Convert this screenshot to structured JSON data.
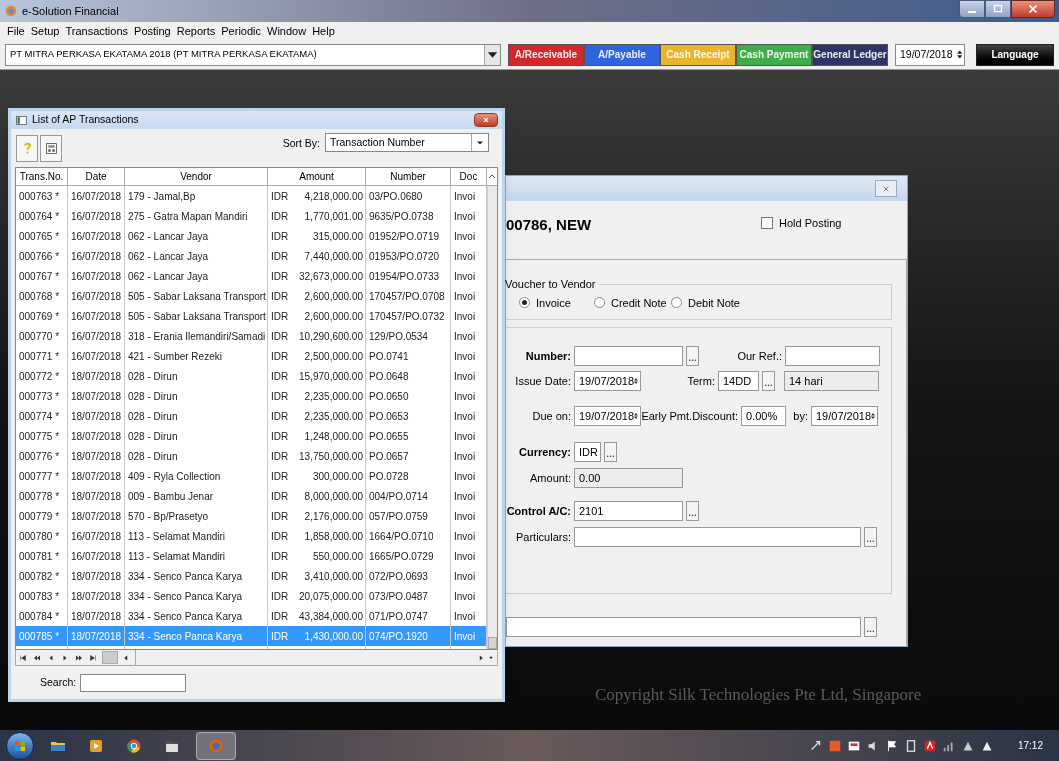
{
  "window": {
    "title": "e-Solution Financial"
  },
  "menu": [
    "File",
    "Setup",
    "Transactions",
    "Posting",
    "Reports",
    "Periodic",
    "Window",
    "Help"
  ],
  "toolbar": {
    "company": "PT MITRA PERKASA EKATAMA 2018 (PT MITRA PERKASA EKATAMA)",
    "modules": [
      {
        "label": "A/Receivable",
        "color": "#d2282c"
      },
      {
        "label": "A/Payable",
        "color": "#2f63e0"
      },
      {
        "label": "Cash Receipt",
        "color": "#e9b52c"
      },
      {
        "label": "Cash Payment",
        "color": "#3fae4a"
      },
      {
        "label": "General Ledger",
        "color": "#2e3566"
      }
    ],
    "date": "19/07/2018",
    "language": "Language"
  },
  "list_window": {
    "title": "List of AP Transactions",
    "sort_by_label": "Sort By:",
    "sort_by": "Transaction Number",
    "columns": [
      "Trans.No.",
      "Date",
      "Vendor",
      "Amount",
      "Number",
      "Doc"
    ],
    "rows": [
      {
        "trans_no": "000763 *",
        "date": "16/07/2018",
        "vendor": "179 - Jamal,Bp",
        "amount": {
          "currency": "IDR",
          "value": "4,218,000.00"
        },
        "number": "03/PO.0680",
        "doc": "Invoi",
        "selected": false
      },
      {
        "trans_no": "000764 *",
        "date": "16/07/2018",
        "vendor": "275 - Gatra Mapan Mandiri",
        "amount": {
          "currency": "IDR",
          "value": "1,770,001.00"
        },
        "number": "9635/PO.0738",
        "doc": "Invoi",
        "selected": false
      },
      {
        "trans_no": "000765 *",
        "date": "16/07/2018",
        "vendor": "062 - Lancar Jaya",
        "amount": {
          "currency": "IDR",
          "value": "315,000.00"
        },
        "number": "01952/PO.0719",
        "doc": "Invoi",
        "selected": false
      },
      {
        "trans_no": "000766 *",
        "date": "16/07/2018",
        "vendor": "062 - Lancar Jaya",
        "amount": {
          "currency": "IDR",
          "value": "7,440,000.00"
        },
        "number": "01953/PO.0720",
        "doc": "Invoi",
        "selected": false
      },
      {
        "trans_no": "000767 *",
        "date": "16/07/2018",
        "vendor": "062 - Lancar Jaya",
        "amount": {
          "currency": "IDR",
          "value": "32,673,000.00"
        },
        "number": "01954/PO.0733",
        "doc": "Invoi",
        "selected": false
      },
      {
        "trans_no": "000768 *",
        "date": "16/07/2018",
        "vendor": "505 - Sabar Laksana Transport",
        "amount": {
          "currency": "IDR",
          "value": "2,600,000.00"
        },
        "number": "170457/PO.0708",
        "doc": "Invoi",
        "selected": false
      },
      {
        "trans_no": "000769 *",
        "date": "16/07/2018",
        "vendor": "505 - Sabar Laksana Transport",
        "amount": {
          "currency": "IDR",
          "value": "2,600,000.00"
        },
        "number": "170457/PO.0732",
        "doc": "Invoi",
        "selected": false
      },
      {
        "trans_no": "000770 *",
        "date": "16/07/2018",
        "vendor": "318 - Erania Ilemandiri/Samadi",
        "amount": {
          "currency": "IDR",
          "value": "10,290,600.00"
        },
        "number": "129/PO.0534",
        "doc": "Invoi",
        "selected": false
      },
      {
        "trans_no": "000771 *",
        "date": "16/07/2018",
        "vendor": "421 - Sumber Rezeki",
        "amount": {
          "currency": "IDR",
          "value": "2,500,000.00"
        },
        "number": "PO.0741",
        "doc": "Invoi",
        "selected": false
      },
      {
        "trans_no": "000772 *",
        "date": "18/07/2018",
        "vendor": "028 - Dirun",
        "amount": {
          "currency": "IDR",
          "value": "15,970,000.00"
        },
        "number": "PO.0648",
        "doc": "Invoi",
        "selected": false
      },
      {
        "trans_no": "000773 *",
        "date": "18/07/2018",
        "vendor": "028 - Dirun",
        "amount": {
          "currency": "IDR",
          "value": "2,235,000.00"
        },
        "number": "PO.0650",
        "doc": "Invoi",
        "selected": false
      },
      {
        "trans_no": "000774 *",
        "date": "18/07/2018",
        "vendor": "028 - Dirun",
        "amount": {
          "currency": "IDR",
          "value": "2,235,000.00"
        },
        "number": "PO.0653",
        "doc": "Invoi",
        "selected": false
      },
      {
        "trans_no": "000775 *",
        "date": "18/07/2018",
        "vendor": "028 - Dirun",
        "amount": {
          "currency": "IDR",
          "value": "1,248,000.00"
        },
        "number": "PO.0655",
        "doc": "Invoi",
        "selected": false
      },
      {
        "trans_no": "000776 *",
        "date": "18/07/2018",
        "vendor": "028 - Dirun",
        "amount": {
          "currency": "IDR",
          "value": "13,750,000.00"
        },
        "number": "PO.0657",
        "doc": "Invoi",
        "selected": false
      },
      {
        "trans_no": "000777 *",
        "date": "18/07/2018",
        "vendor": "409 - Ryla Collection",
        "amount": {
          "currency": "IDR",
          "value": "300,000.00"
        },
        "number": "PO.0728",
        "doc": "Invoi",
        "selected": false
      },
      {
        "trans_no": "000778 *",
        "date": "18/07/2018",
        "vendor": "009 - Bambu Jenar",
        "amount": {
          "currency": "IDR",
          "value": "8,000,000.00"
        },
        "number": "004/PO.0714",
        "doc": "Invoi",
        "selected": false
      },
      {
        "trans_no": "000779 *",
        "date": "18/07/2018",
        "vendor": "570 - Bp/Prasetyo",
        "amount": {
          "currency": "IDR",
          "value": "2,176,000.00"
        },
        "number": "057/PO.0759",
        "doc": "Invoi",
        "selected": false
      },
      {
        "trans_no": "000780 *",
        "date": "16/07/2018",
        "vendor": "113 - Selamat Mandiri",
        "amount": {
          "currency": "IDR",
          "value": "1,858,000.00"
        },
        "number": "1664/PO.0710",
        "doc": "Invoi",
        "selected": false
      },
      {
        "trans_no": "000781 *",
        "date": "16/07/2018",
        "vendor": "113 - Selamat Mandiri",
        "amount": {
          "currency": "IDR",
          "value": "550,000.00"
        },
        "number": "1665/PO.0729",
        "doc": "Invoi",
        "selected": false
      },
      {
        "trans_no": "000782 *",
        "date": "18/07/2018",
        "vendor": "334 - Senco Panca Karya",
        "amount": {
          "currency": "IDR",
          "value": "3,410,000.00"
        },
        "number": "072/PO.0693",
        "doc": "Invoi",
        "selected": false
      },
      {
        "trans_no": "000783 *",
        "date": "18/07/2018",
        "vendor": "334 - Senco Panca Karya",
        "amount": {
          "currency": "IDR",
          "value": "20,075,000.00"
        },
        "number": "073/PO.0487",
        "doc": "Invoi",
        "selected": false
      },
      {
        "trans_no": "000784 *",
        "date": "18/07/2018",
        "vendor": "334 - Senco Panca Karya",
        "amount": {
          "currency": "IDR",
          "value": "43,384,000.00"
        },
        "number": "071/PO.0747",
        "doc": "Invoi",
        "selected": false
      },
      {
        "trans_no": "000785 *",
        "date": "18/07/2018",
        "vendor": "334 - Senco Panca Karya",
        "amount": {
          "currency": "IDR",
          "value": "1,430,000.00"
        },
        "number": "074/PO.1920",
        "doc": "Invoi",
        "selected": true
      }
    ],
    "search_label": "Search:"
  },
  "voucher_dialog": {
    "heading": "00786, NEW",
    "hold_posting": {
      "label": "Hold Posting",
      "checked": false
    },
    "voucher_group": {
      "title": "Voucher to Vendor",
      "options": [
        {
          "label": "Invoice",
          "selected": true
        },
        {
          "label": "Credit Note",
          "selected": false
        },
        {
          "label": "Debit Note",
          "selected": false
        }
      ]
    },
    "number_label": "Number:",
    "our_ref_label": "Our Ref.:",
    "issue_date_label": "Issue Date:",
    "issue_date": "19/07/2018",
    "term_label": "Term:",
    "term": "14DD",
    "term_description": "14 hari",
    "due_on_label": "Due on:",
    "due_on": "19/07/2018",
    "discount_label": "Early Pmt.Discount:",
    "discount": "0.00%",
    "by_label": "by:",
    "by": "19/07/2018",
    "currency_label": "Currency:",
    "currency": "IDR",
    "amount_label": "Amount:",
    "amount": "0.00",
    "control_ac_label": "Control A/C:",
    "control_ac": "2101",
    "particulars_label": "Particulars:"
  },
  "copyright": "Copyright Silk Technologies Pte Ltd, Singapore",
  "taskbar": {
    "clock": "17:12"
  }
}
